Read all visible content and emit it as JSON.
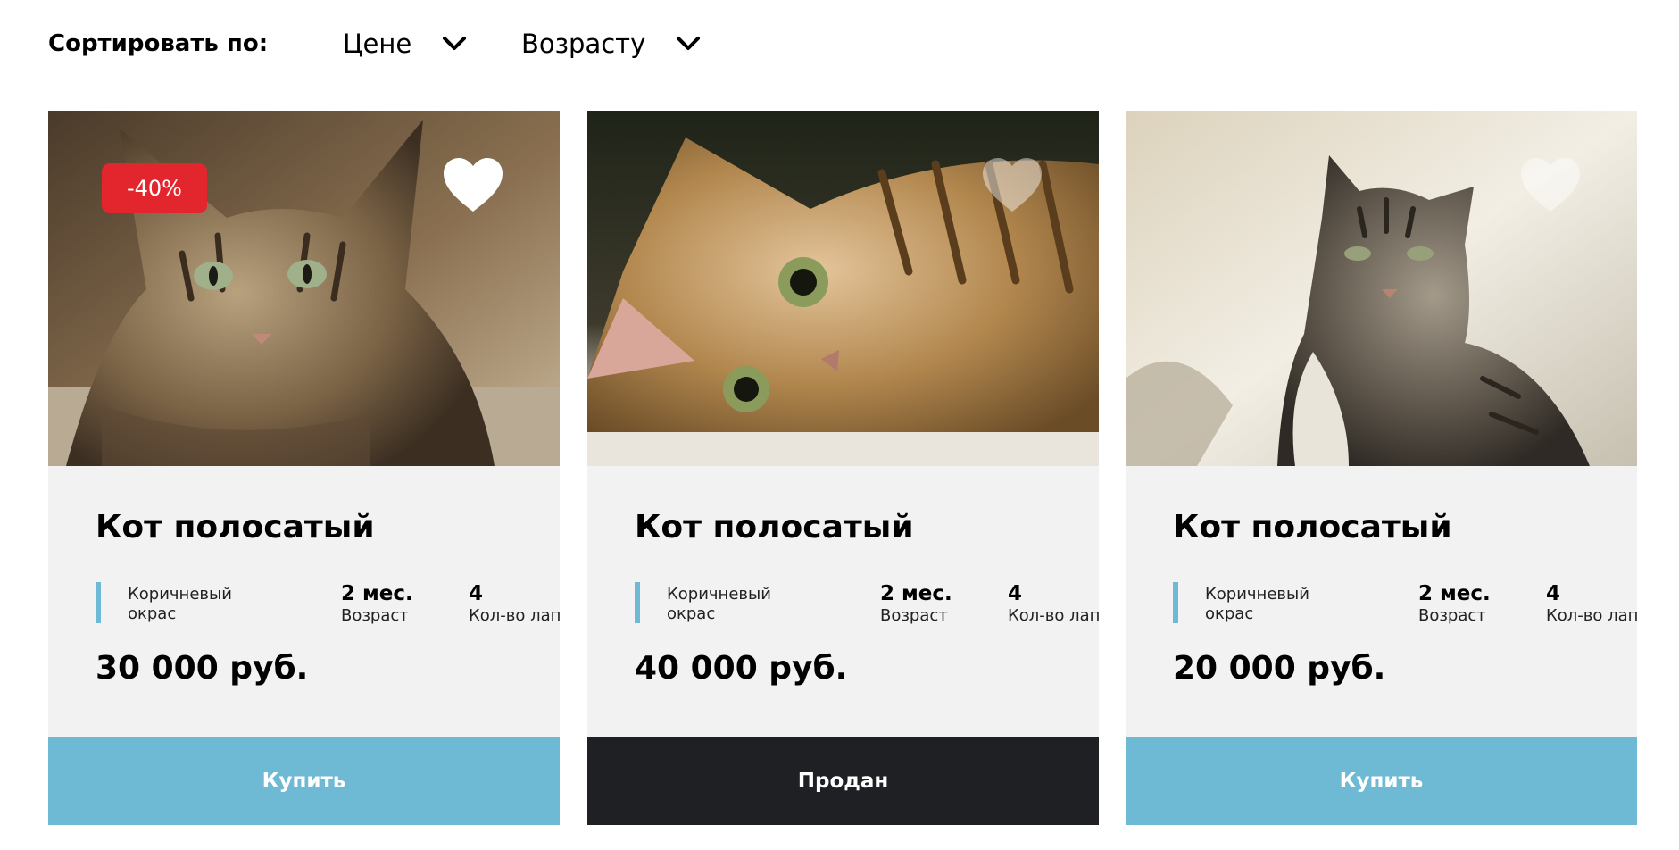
{
  "sort": {
    "label": "Сортировать по:",
    "options": [
      {
        "label": "Цене",
        "icon": "chevron-down-icon"
      },
      {
        "label": "Возрасту",
        "icon": "chevron-down-icon"
      }
    ]
  },
  "colors": {
    "accent": "#6eb9d4",
    "sold": "#1f2023",
    "badge": "#e3262d",
    "card_bg": "#f2f2f2"
  },
  "cards": [
    {
      "photo": "tabby-cat-photo",
      "discount": "-40%",
      "favorite": "heart-icon",
      "favorite_state": "active",
      "title": "Кот полосатый",
      "color_label": "Коричневый окрас",
      "age_value": "2 мес.",
      "age_caption": "Возраст",
      "paws_value": "4",
      "paws_caption": "Кол-во лап",
      "price": "30 000 руб.",
      "button": "Купить",
      "button_state": "available"
    },
    {
      "photo": "tabby-cat-lying-photo",
      "favorite": "heart-icon",
      "favorite_state": "inactive",
      "title": "Кот полосатый",
      "color_label": "Коричневый окрас",
      "age_value": "2 мес.",
      "age_caption": "Возраст",
      "paws_value": "4",
      "paws_caption": "Кол-во лап",
      "price": "40 000 руб.",
      "button": "Продан",
      "button_state": "sold"
    },
    {
      "photo": "grey-tabby-cat-sitting-photo",
      "favorite": "heart-icon",
      "favorite_state": "inactive",
      "title": "Кот полосатый",
      "color_label": "Коричневый окрас",
      "age_value": "2 мес.",
      "age_caption": "Возраст",
      "paws_value": "4",
      "paws_caption": "Кол-во лап",
      "price": "20 000 руб.",
      "button": "Купить",
      "button_state": "available"
    }
  ]
}
